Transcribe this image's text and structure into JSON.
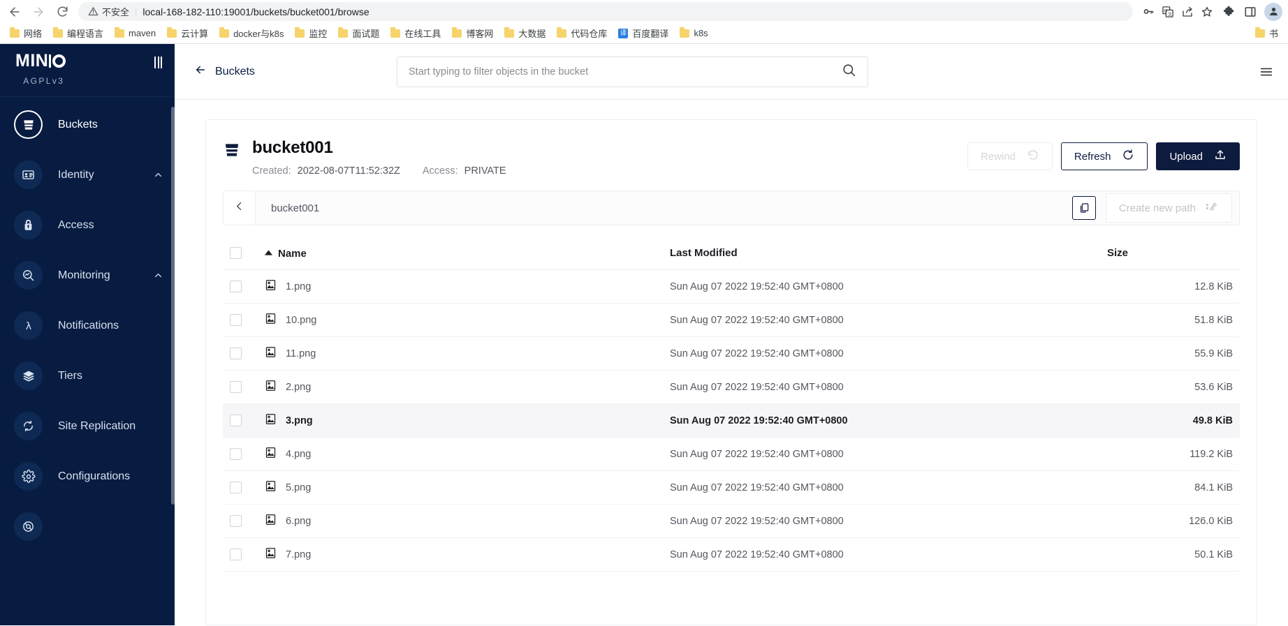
{
  "browser": {
    "back_icon": "arrow-left-icon",
    "forward_icon": "arrow-right-icon",
    "reload_icon": "reload-icon",
    "security_warning": "不安全",
    "url": "local-168-182-110:19001/buckets/bucket001/browse",
    "omnibox_icons": [
      "key-icon",
      "translate-icon",
      "share-icon",
      "bookmark-star-icon"
    ],
    "toolbar_icons": [
      "extensions-puzzle-icon",
      "side-panel-icon",
      "profile-avatar-icon"
    ],
    "bookmarks": [
      {
        "label": "网络",
        "icon": "folder-icon"
      },
      {
        "label": "编程语言",
        "icon": "folder-icon"
      },
      {
        "label": "maven",
        "icon": "folder-icon"
      },
      {
        "label": "云计算",
        "icon": "folder-icon"
      },
      {
        "label": "docker与k8s",
        "icon": "folder-icon"
      },
      {
        "label": "监控",
        "icon": "folder-icon"
      },
      {
        "label": "面试题",
        "icon": "folder-icon"
      },
      {
        "label": "在线工具",
        "icon": "folder-icon"
      },
      {
        "label": "博客网",
        "icon": "folder-icon"
      },
      {
        "label": "大数据",
        "icon": "folder-icon"
      },
      {
        "label": "代码仓库",
        "icon": "folder-icon"
      },
      {
        "label": "百度翻译",
        "icon": "translate-favicon"
      },
      {
        "label": "k8s",
        "icon": "folder-icon"
      }
    ],
    "bookmarks_overflow": {
      "label": "书",
      "icon": "folder-icon"
    }
  },
  "sidebar": {
    "logo": "MINIO",
    "license": "AGPLv3",
    "collapse_icon": "collapse-menu-icon",
    "items": [
      {
        "label": "Buckets",
        "icon": "bucket-icon",
        "active": true,
        "expandable": false
      },
      {
        "label": "Identity",
        "icon": "identity-card-icon",
        "active": false,
        "expandable": true
      },
      {
        "label": "Access",
        "icon": "lock-icon",
        "active": false,
        "expandable": false
      },
      {
        "label": "Monitoring",
        "icon": "monitoring-icon",
        "active": false,
        "expandable": true
      },
      {
        "label": "Notifications",
        "icon": "lambda-icon",
        "active": false,
        "expandable": false
      },
      {
        "label": "Tiers",
        "icon": "layers-icon",
        "active": false,
        "expandable": false
      },
      {
        "label": "Site Replication",
        "icon": "replication-icon",
        "active": false,
        "expandable": false
      },
      {
        "label": "Configurations",
        "icon": "gear-icon",
        "active": false,
        "expandable": false
      }
    ]
  },
  "topbar": {
    "back_label": "Buckets",
    "back_icon": "arrow-left-icon",
    "search_placeholder": "Start typing to filter objects in the bucket",
    "search_value": "",
    "search_icon": "search-icon",
    "right_icon": "settings-icon"
  },
  "bucket": {
    "icon": "bucket-icon",
    "name": "bucket001",
    "created_label": "Created:",
    "created_value": "2022-08-07T11:52:32Z",
    "access_label": "Access:",
    "access_value": "PRIVATE",
    "actions": [
      {
        "label": "Rewind",
        "icon": "rewind-icon",
        "style": "disabled"
      },
      {
        "label": "Refresh",
        "icon": "refresh-icon",
        "style": "outline"
      },
      {
        "label": "Upload",
        "icon": "upload-icon",
        "style": "primary"
      }
    ]
  },
  "path_bar": {
    "back_icon": "chevron-left-icon",
    "path": "bucket001",
    "copy_icon": "copy-icon",
    "create_path_label": "Create new path",
    "create_path_icon": "path-slash-icon"
  },
  "table": {
    "columns": [
      {
        "key": "name",
        "label": "Name",
        "sorted": "asc",
        "sort_icon": "caret-up-icon"
      },
      {
        "key": "modified",
        "label": "Last Modified"
      },
      {
        "key": "size",
        "label": "Size"
      }
    ],
    "rows": [
      {
        "name": "1.png",
        "icon": "image-file-icon",
        "modified": "Sun Aug 07 2022 19:52:40 GMT+0800",
        "size": "12.8 KiB",
        "hovered": false
      },
      {
        "name": "10.png",
        "icon": "image-file-icon",
        "modified": "Sun Aug 07 2022 19:52:40 GMT+0800",
        "size": "51.8 KiB",
        "hovered": false
      },
      {
        "name": "11.png",
        "icon": "image-file-icon",
        "modified": "Sun Aug 07 2022 19:52:40 GMT+0800",
        "size": "55.9 KiB",
        "hovered": false
      },
      {
        "name": "2.png",
        "icon": "image-file-icon",
        "modified": "Sun Aug 07 2022 19:52:40 GMT+0800",
        "size": "53.6 KiB",
        "hovered": false
      },
      {
        "name": "3.png",
        "icon": "image-file-icon",
        "modified": "Sun Aug 07 2022 19:52:40 GMT+0800",
        "size": "49.8 KiB",
        "hovered": true
      },
      {
        "name": "4.png",
        "icon": "image-file-icon",
        "modified": "Sun Aug 07 2022 19:52:40 GMT+0800",
        "size": "119.2 KiB",
        "hovered": false
      },
      {
        "name": "5.png",
        "icon": "image-file-icon",
        "modified": "Sun Aug 07 2022 19:52:40 GMT+0800",
        "size": "84.1 KiB",
        "hovered": false
      },
      {
        "name": "6.png",
        "icon": "image-file-icon",
        "modified": "Sun Aug 07 2022 19:52:40 GMT+0800",
        "size": "126.0 KiB",
        "hovered": false
      },
      {
        "name": "7.png",
        "icon": "image-file-icon",
        "modified": "Sun Aug 07 2022 19:52:40 GMT+0800",
        "size": "50.1 KiB",
        "hovered": false
      }
    ]
  },
  "colors": {
    "sidebar_bg": "#081c42",
    "primary": "#0d1b3e",
    "bookmark_folder": "#f6d36b",
    "translate_blue": "#2a7fdd"
  }
}
